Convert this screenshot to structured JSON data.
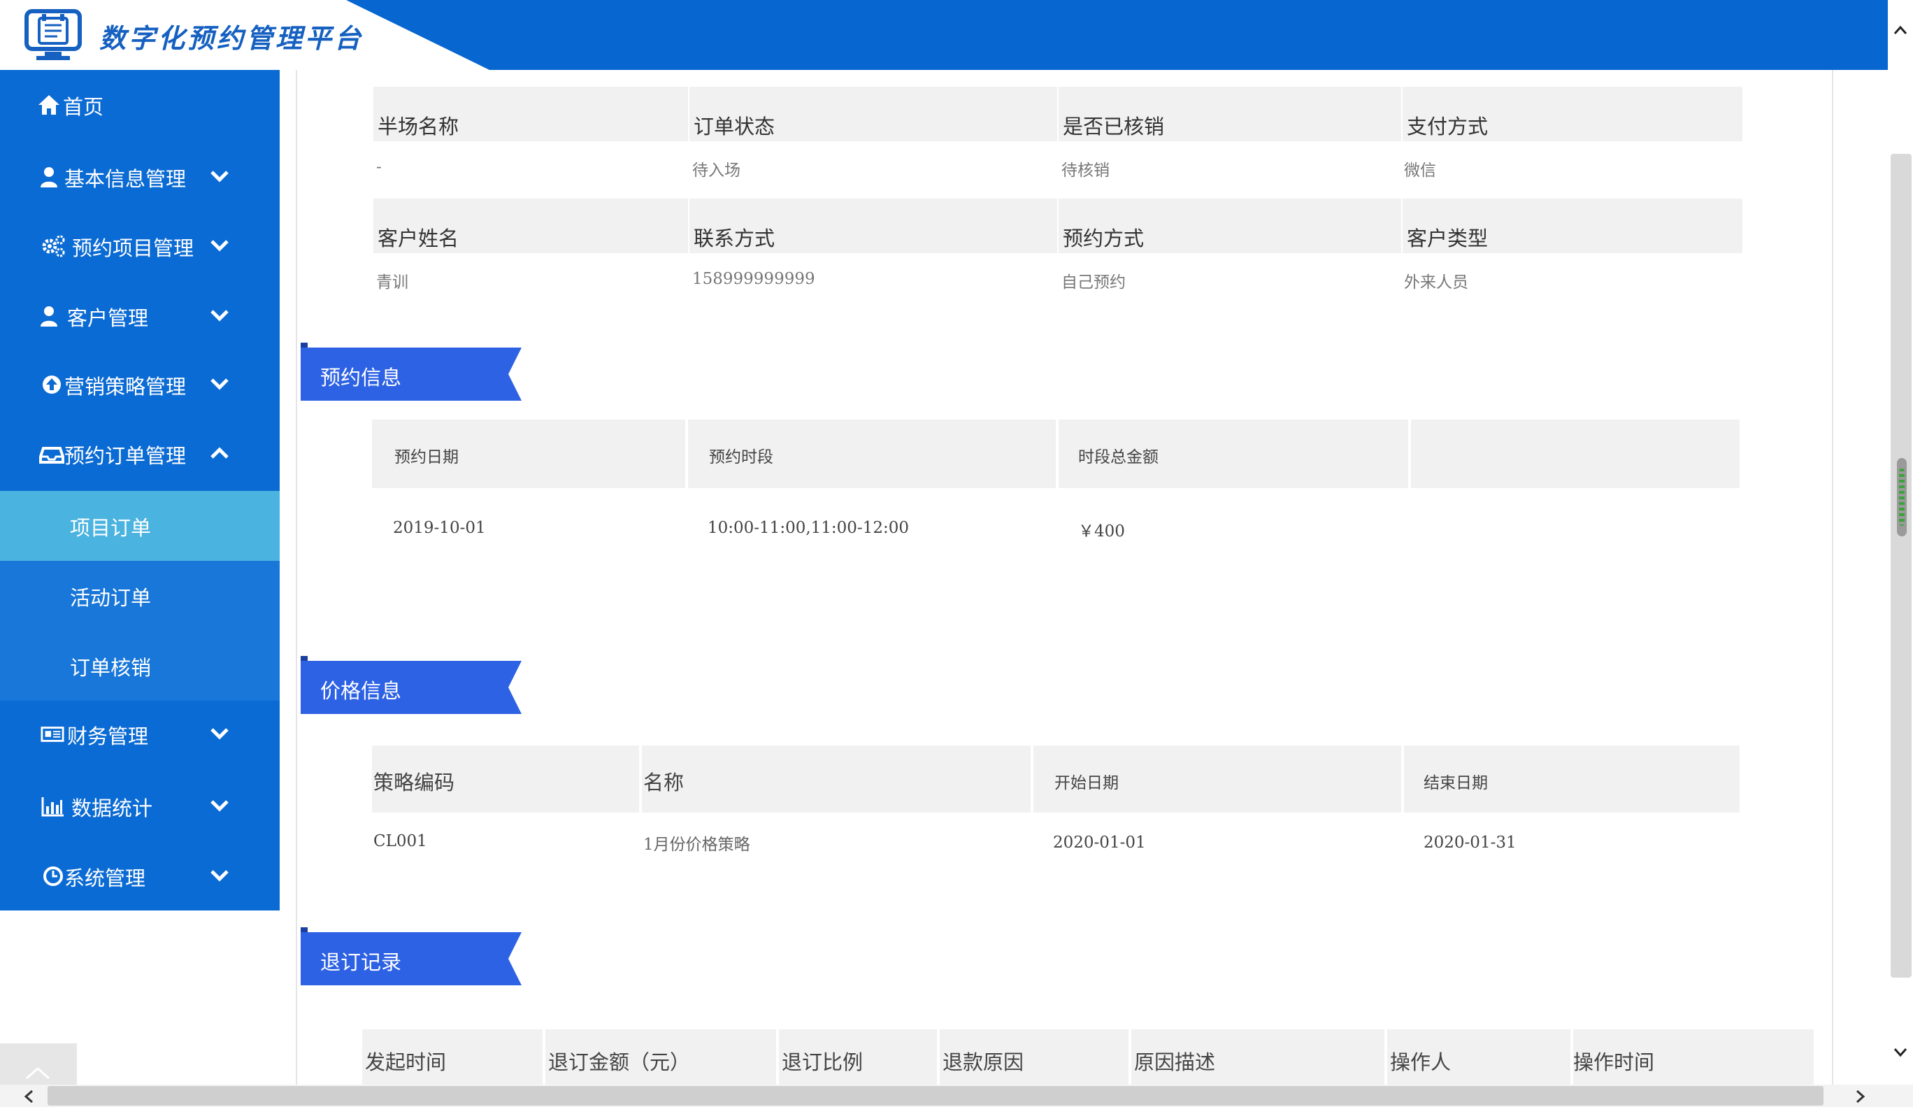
{
  "app": {
    "title": "数字化预约管理平台"
  },
  "sidebar": {
    "items": [
      {
        "label": "首页",
        "icon": "home-icon"
      },
      {
        "label": "基本信息管理",
        "icon": "user-icon"
      },
      {
        "label": "预约项目管理",
        "icon": "gears-icon"
      },
      {
        "label": "客户管理",
        "icon": "user-icon"
      },
      {
        "label": "营销策略管理",
        "icon": "arrow-up-circle-icon"
      },
      {
        "label": "预约订单管理",
        "icon": "inbox-icon"
      },
      {
        "label": "财务管理",
        "icon": "newspaper-icon"
      },
      {
        "label": "数据统计",
        "icon": "bar-chart-icon"
      },
      {
        "label": "系统管理",
        "icon": "clock-icon"
      }
    ],
    "subitems": [
      {
        "label": "项目订单",
        "active": true
      },
      {
        "label": "活动订单",
        "active": false
      },
      {
        "label": "订单核销",
        "active": false
      }
    ]
  },
  "order_info": {
    "row1_headers": [
      "半场名称",
      "订单状态",
      "是否已核销",
      "支付方式"
    ],
    "row1_values": [
      "-",
      "待入场",
      "待核销",
      "微信"
    ],
    "row2_headers": [
      "客户姓名",
      "联系方式",
      "预约方式",
      "客户类型"
    ],
    "row2_values": [
      "青训",
      "158999999999",
      "自己预约",
      "外来人员"
    ]
  },
  "booking": {
    "title": "预约信息",
    "headers": [
      "预约日期",
      "预约时段",
      "时段总金额",
      ""
    ],
    "values": [
      "2019-10-01",
      "10:00-11:00,11:00-12:00",
      "￥400",
      ""
    ]
  },
  "price": {
    "title": "价格信息",
    "headers": [
      "策略编码",
      "名称",
      "开始日期",
      "结束日期"
    ],
    "values": [
      "CL001",
      "1月份价格策略",
      "2020-01-01",
      "2020-01-31"
    ]
  },
  "refund": {
    "title": "退订记录",
    "headers": [
      "发起时间",
      "退订金额（元）",
      "退订比例",
      "退款原因",
      "原因描述",
      "操作人",
      "操作时间"
    ]
  },
  "colors": {
    "header_blue": "#0766cf",
    "sidebar_blue": "#0b6bd4",
    "active_sub": "#4ab3e0",
    "section_tag": "#2e62e4"
  }
}
